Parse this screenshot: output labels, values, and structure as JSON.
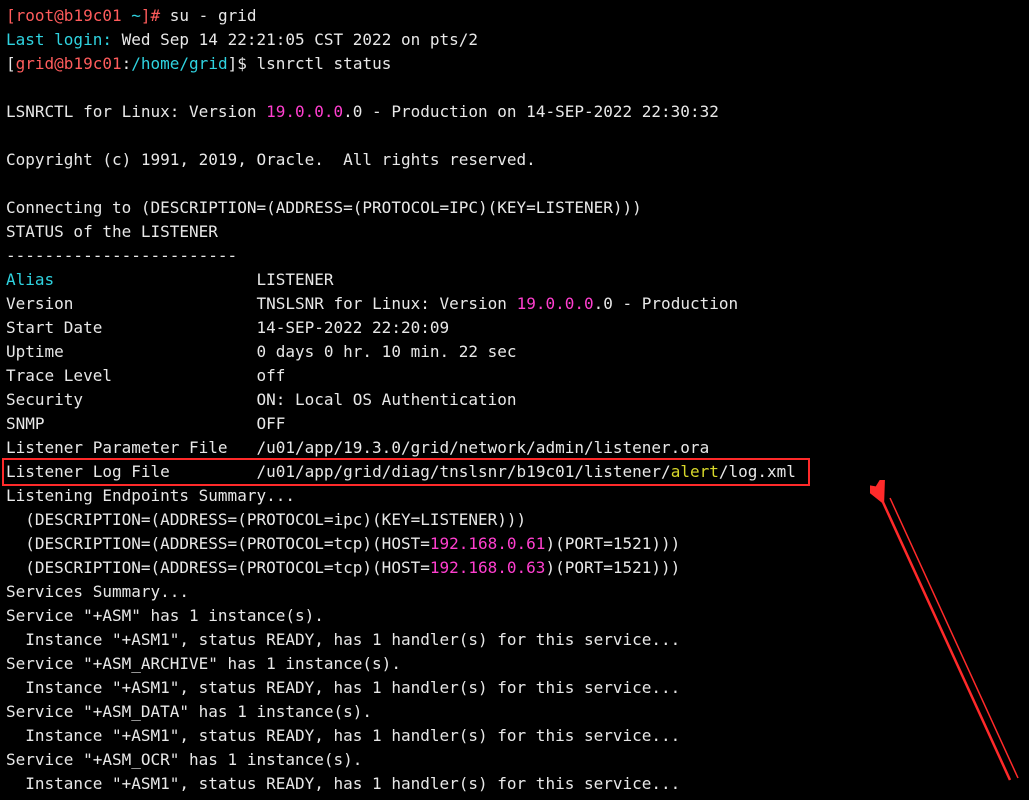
{
  "colors": {
    "bg": "#000000",
    "fg": "#e8e8e8",
    "cyan": "#2fd3e0",
    "red": "#ff5c5c",
    "magenta": "#ff3fcf",
    "yellow": "#d8d82a",
    "box": "#ff2a2a"
  },
  "prompt1": {
    "open": "[",
    "user": "root@b19c01 ",
    "path": "~",
    "close": "]# ",
    "cmd": "su - grid"
  },
  "lastlogin": {
    "label": "Last login:",
    "value": " Wed Sep 14 22:21:05 CST 2022 on pts/2"
  },
  "prompt2": {
    "open": "[",
    "user": "grid@b19c01",
    "sep": ":",
    "path": "/home/grid",
    "close": "]$ ",
    "cmd": "lsnrctl status"
  },
  "header": {
    "pre": "LSNRCTL for Linux: Version ",
    "ver": "19.0.0.0",
    "post": ".0 - Production on 14-SEP-2022 22:30:32"
  },
  "copyright": "Copyright (c) 1991, 2019, Oracle.  All rights reserved.",
  "connecting": "Connecting to (DESCRIPTION=(ADDRESS=(PROTOCOL=IPC)(KEY=LISTENER)))",
  "statusTitle": "STATUS of the LISTENER",
  "dashes": "------------------------",
  "fields": {
    "alias": {
      "k": "Alias",
      "v": "LISTENER"
    },
    "version": {
      "k": "Version",
      "pre": "TNSLSNR for Linux: Version ",
      "ver": "19.0.0.0",
      "post": ".0 - Production"
    },
    "startDate": {
      "k": "Start Date",
      "v": "14-SEP-2022 22:20:09"
    },
    "uptime": {
      "k": "Uptime",
      "v": "0 days 0 hr. 10 min. 22 sec"
    },
    "trace": {
      "k": "Trace Level",
      "v": "off"
    },
    "security": {
      "k": "Security",
      "v": "ON: Local OS Authentication"
    },
    "snmp": {
      "k": "SNMP",
      "v": "OFF"
    },
    "paramFile": {
      "k": "Listener Parameter File ",
      "v": "/u01/app/19.3.0/grid/network/admin/listener.ora"
    },
    "logFile": {
      "k": "Listener Log File",
      "pre": "/u01/app/grid/diag/tnslsnr/b19c01/listener/",
      "hl": "alert",
      "post": "/log.xml"
    }
  },
  "endpointsTitle": "Listening Endpoints Summary...",
  "ep1": "  (DESCRIPTION=(ADDRESS=(PROTOCOL=ipc)(KEY=LISTENER)))",
  "ep2": {
    "pre": "  (DESCRIPTION=(ADDRESS=(PROTOCOL=tcp)(HOST=",
    "ip": "192.168.0.61",
    "post": ")(PORT=1521)))"
  },
  "ep3": {
    "pre": "  (DESCRIPTION=(ADDRESS=(PROTOCOL=tcp)(HOST=",
    "ip": "192.168.0.63",
    "post": ")(PORT=1521)))"
  },
  "servicesTitle": "Services Summary...",
  "svc1": {
    "line": "Service \"+ASM\" has 1 instance(s).",
    "inst": "  Instance \"+ASM1\", status READY, has 1 handler(s) for this service..."
  },
  "svc2": {
    "line": "Service \"+ASM_ARCHIVE\" has 1 instance(s).",
    "inst": "  Instance \"+ASM1\", status READY, has 1 handler(s) for this service..."
  },
  "svc3": {
    "line": "Service \"+ASM_DATA\" has 1 instance(s).",
    "inst": "  Instance \"+ASM1\", status READY, has 1 handler(s) for this service..."
  },
  "svc4": {
    "line": "Service \"+ASM_OCR\" has 1 instance(s).",
    "inst": "  Instance \"+ASM1\", status READY, has 1 handler(s) for this service..."
  }
}
